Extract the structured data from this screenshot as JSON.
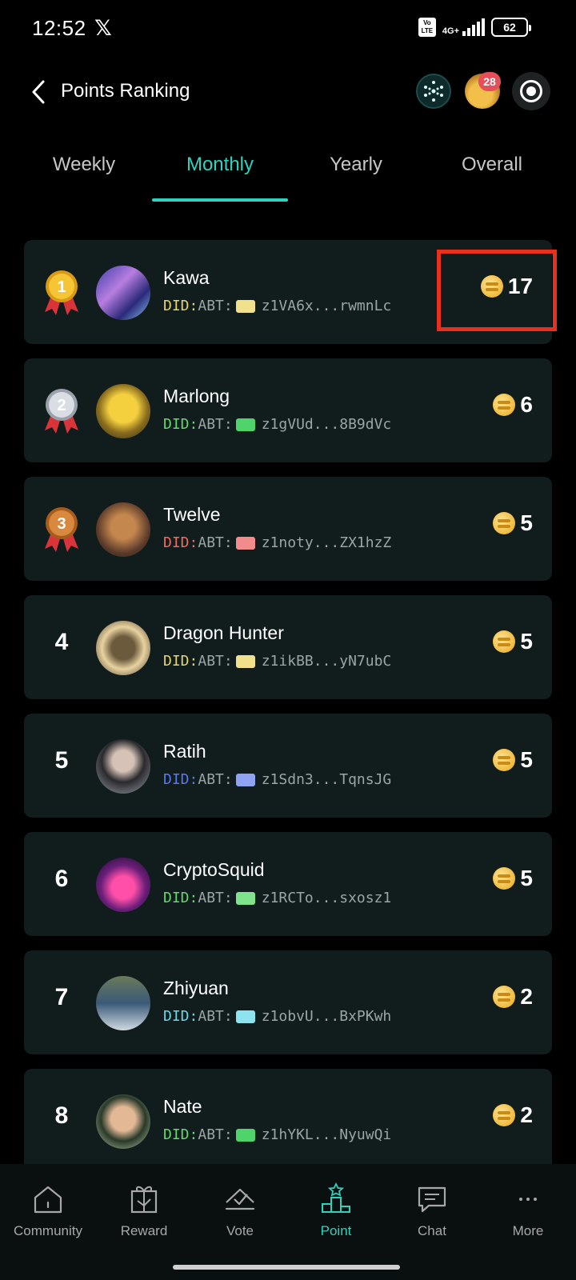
{
  "status_bar": {
    "time": "12:52",
    "battery": "62",
    "network": "4G+",
    "volte": "Vo LTE"
  },
  "header": {
    "title": "Points Ranking",
    "notification_count": "28"
  },
  "tabs": [
    {
      "label": "Weekly",
      "active": false
    },
    {
      "label": "Monthly",
      "active": true
    },
    {
      "label": "Yearly",
      "active": false
    },
    {
      "label": "Overall",
      "active": false
    }
  ],
  "ranking": [
    {
      "rank": "1",
      "name": "Kawa",
      "did_prefix": "DID:",
      "did_abt": "ABT:",
      "did_id": "z1VA6x...rwmnLc",
      "points": "17",
      "did_color": "#e6d46a",
      "chip_color": "#f1e18c",
      "medal": "gold"
    },
    {
      "rank": "2",
      "name": "Marlong",
      "did_prefix": "DID:",
      "did_abt": "ABT:",
      "did_id": "z1gVUd...8B9dVc",
      "points": "6",
      "did_color": "#63d86b",
      "chip_color": "#4fd46b",
      "medal": "silver"
    },
    {
      "rank": "3",
      "name": "Twelve",
      "did_prefix": "DID:",
      "did_abt": "ABT:",
      "did_id": "z1noty...ZX1hzZ",
      "points": "5",
      "did_color": "#ee6b62",
      "chip_color": "#f28c8c",
      "medal": "bronze"
    },
    {
      "rank": "4",
      "name": "Dragon Hunter",
      "did_prefix": "DID:",
      "did_abt": "ABT:",
      "did_id": "z1ikBB...yN7ubC",
      "points": "5",
      "did_color": "#e6d46a",
      "chip_color": "#f1e18c",
      "medal": ""
    },
    {
      "rank": "5",
      "name": "Ratih",
      "did_prefix": "DID:",
      "did_abt": "ABT:",
      "did_id": "z1Sdn3...TqnsJG",
      "points": "5",
      "did_color": "#5a78e8",
      "chip_color": "#8fa3f2",
      "medal": ""
    },
    {
      "rank": "6",
      "name": "CryptoSquid",
      "did_prefix": "DID:",
      "did_abt": "ABT:",
      "did_id": "z1RCTo...sxosz1",
      "points": "5",
      "did_color": "#63d86b",
      "chip_color": "#7ee38a",
      "medal": ""
    },
    {
      "rank": "7",
      "name": "Zhiyuan",
      "did_prefix": "DID:",
      "did_abt": "ABT:",
      "did_id": "z1obvU...BxPKwh",
      "points": "2",
      "did_color": "#6ad6e6",
      "chip_color": "#8de4ef",
      "medal": ""
    },
    {
      "rank": "8",
      "name": "Nate",
      "did_prefix": "DID:",
      "did_abt": "ABT:",
      "did_id": "z1hYKL...NyuwQi",
      "points": "2",
      "did_color": "#63d86b",
      "chip_color": "#4fd46b",
      "medal": ""
    }
  ],
  "bottom_nav": [
    {
      "label": "Community",
      "icon": "home-icon",
      "active": false
    },
    {
      "label": "Reward",
      "icon": "gift-icon",
      "active": false
    },
    {
      "label": "Vote",
      "icon": "vote-icon",
      "active": false
    },
    {
      "label": "Point",
      "icon": "podium-icon",
      "active": true
    },
    {
      "label": "Chat",
      "icon": "chat-icon",
      "active": false
    },
    {
      "label": "More",
      "icon": "more-icon",
      "active": false
    }
  ],
  "colors": {
    "accent": "#2ed3bd",
    "card_bg": "#111c1c",
    "highlight": "#e8301f",
    "badge": "#e3505a"
  }
}
